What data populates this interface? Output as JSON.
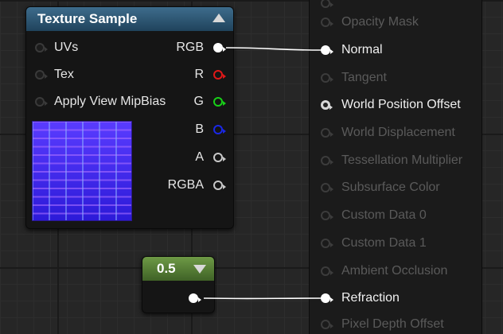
{
  "texture_sample": {
    "title": "Texture Sample",
    "inputs": [
      "UVs",
      "Tex",
      "Apply View MipBias"
    ],
    "outputs": [
      "RGB",
      "R",
      "G",
      "B",
      "A",
      "RGBA"
    ]
  },
  "constant": {
    "value": "0.5"
  },
  "material_result": {
    "inputs": [
      "Opacity Mask",
      "Normal",
      "Tangent",
      "World Position Offset",
      "World Displacement",
      "Tessellation Multiplier",
      "Subsurface Color",
      "Custom Data 0",
      "Custom Data 1",
      "Ambient Occlusion",
      "Refraction",
      "Pixel Depth Offset"
    ]
  },
  "colors": {
    "texture_header": "#2e5a78",
    "constant_header": "#5a8436",
    "pin_r": "#e01818",
    "pin_g": "#18d018",
    "pin_b": "#1a28e6",
    "wire": "#ffffff"
  }
}
